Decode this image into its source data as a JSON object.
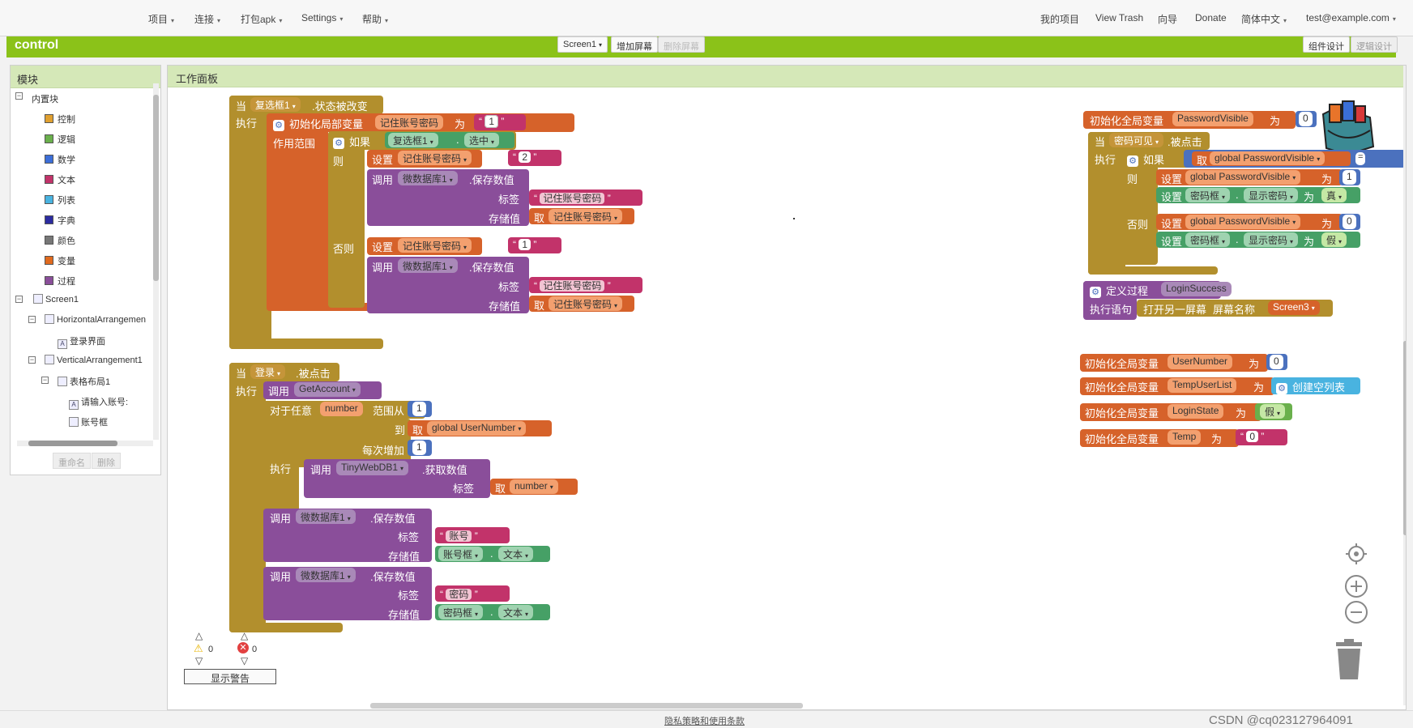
{
  "topbar": {
    "menus": [
      "项目",
      "连接",
      "打包apk",
      "Settings",
      "帮助"
    ],
    "right": [
      "我的项目",
      "View Trash",
      "向导",
      "Donate",
      "简体中文",
      "test@example.com"
    ]
  },
  "app": {
    "name": "control",
    "screen": "Screen1",
    "add_screen": "增加屏幕",
    "remove_screen": "删除屏幕",
    "designer": "组件设计",
    "blocks": "逻辑设计"
  },
  "palette": {
    "title": "模块",
    "builtin": "内置块",
    "categories": [
      {
        "label": "控制",
        "color": "#e0a030"
      },
      {
        "label": "逻辑",
        "color": "#6ab04c"
      },
      {
        "label": "数学",
        "color": "#3c6ed8"
      },
      {
        "label": "文本",
        "color": "#c2336a"
      },
      {
        "label": "列表",
        "color": "#49b3e0"
      },
      {
        "label": "字典",
        "color": "#2c2ca0"
      },
      {
        "label": "颜色",
        "color": "#777777"
      },
      {
        "label": "变量",
        "color": "#e06a1e"
      },
      {
        "label": "过程",
        "color": "#8a4e9a"
      }
    ],
    "tree": [
      "Screen1",
      "HorizontalArrangemen",
      "登录界面",
      "VerticalArrangement1",
      "表格布局1",
      "请输入账号:",
      "账号框"
    ],
    "rename": "重命名",
    "delete": "删除"
  },
  "workspace": {
    "title": "工作面板",
    "warn_count": "0",
    "error_count": "0",
    "show_warnings": "显示警告"
  },
  "blocks": {
    "when": "当",
    "do": "执行",
    "cb_name": "复选框1",
    "cb_event": ".状态被改变",
    "init_local": "初始化局部变量",
    "local_var": "记住账号密码",
    "as": "为",
    "str1": "1",
    "scope": "作用范围",
    "if": "如果",
    "checked": "选中",
    "then": "则",
    "set": "设置",
    "str2": "2",
    "call": "调用",
    "db": "微数据库1",
    "store": ".保存数值",
    "tag": "标签",
    "value": "存储值",
    "get": "取",
    "else": "否则",
    "login_btn": "登录",
    "click": ".被点击",
    "getaccount": "GetAccount",
    "foreach": "对于任意",
    "number": "number",
    "from": "范围从",
    "to": "到",
    "gun": "global UserNumber",
    "step": "每次增加",
    "tinydb": "TinyWebDB1",
    "getval": ".获取数值",
    "s_account": "账号",
    "acct_box": "账号框",
    "text": "文本",
    "s_pwd": "密码",
    "pwd_box": "密码框",
    "init_global": "初始化全局变量",
    "pv": "PasswordVisible",
    "zero": "0",
    "pwd_visible": "密码可见",
    "gpv": "global PasswordVisible",
    "one": "1",
    "show_pwd": "显示密码",
    "true": "真",
    "false": "假",
    "defproc": "定义过程",
    "loginsuccess": "LoginSuccess",
    "exec": "执行语句",
    "openscreen": "打开另一屏幕",
    "screenname": "屏幕名称",
    "screen3": "Screen3",
    "usernumber": "UserNumber",
    "tempuserlist": "TempUserList",
    "createlist": "创建空列表",
    "loginstate": "LoginState",
    "temp": "Temp"
  },
  "footer": {
    "policy": "隐私策略和使用条款",
    "watermark": "CSDN @cq023127964091"
  }
}
